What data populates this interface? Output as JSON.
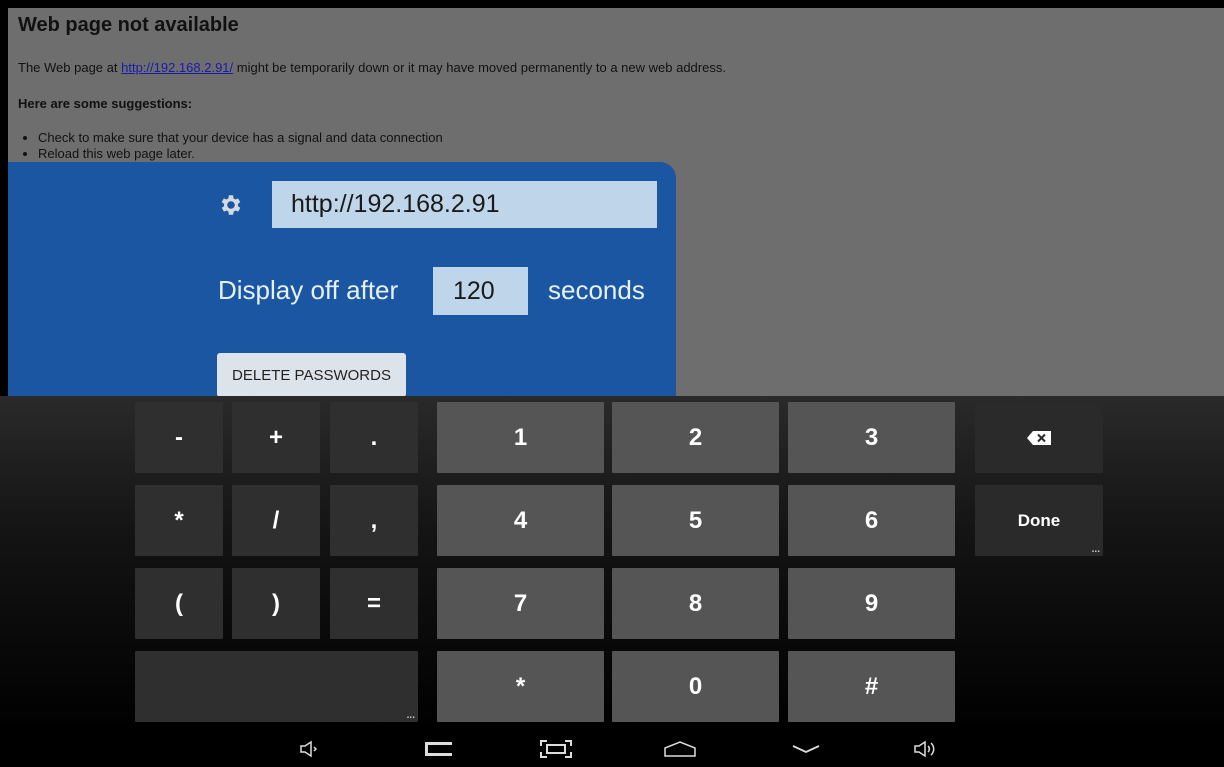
{
  "webpage": {
    "title": "Web page not available",
    "line_prefix": "The Web page at ",
    "link": "http://192.168.2.91/",
    "line_suffix": " might be temporarily down or it may have moved permanently to a new web address.",
    "suggestions_heading": "Here are some suggestions:",
    "suggestions": [
      "Check to make sure that your device has a signal and data connection",
      "Reload this web page later."
    ]
  },
  "panel": {
    "url_value": "http://192.168.2.91",
    "display_label": "Display off after",
    "seconds_value": "120",
    "seconds_label": "seconds",
    "delete_label": "DELETE PASSWORDS",
    "color": "#1a56a2"
  },
  "keyboard": {
    "row1": [
      "-",
      "+",
      ".",
      "1",
      "2",
      "3"
    ],
    "row2": [
      "*",
      "/",
      ",",
      "4",
      "5",
      "6"
    ],
    "row3": [
      "(",
      ")",
      "=",
      "7",
      "8",
      "9"
    ],
    "row4": [
      "",
      "*",
      "0",
      "#"
    ],
    "done_label": "Done",
    "more_marker": "..."
  },
  "navbar": {
    "icons": [
      "volume-down-icon",
      "back-icon",
      "screenshot-icon",
      "home-icon",
      "hide-keyboard-icon",
      "volume-up-icon"
    ]
  }
}
